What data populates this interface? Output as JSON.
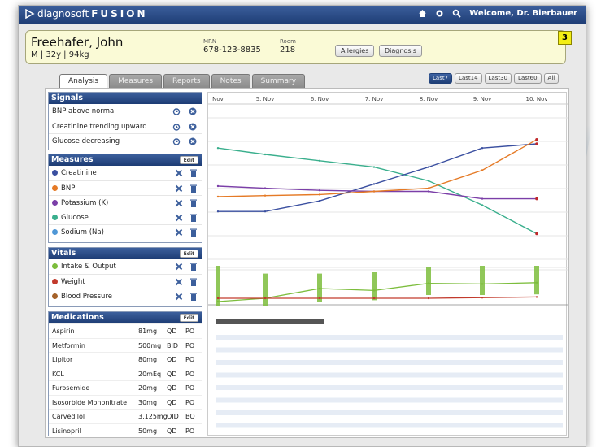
{
  "app": {
    "brand_light": "diagnosoft",
    "brand_bold": "FUSION",
    "welcome": "Welcome, Dr. Bierbauer"
  },
  "patient": {
    "name": "Freehafer, John",
    "demographics": "M | 32y | 94kg",
    "mrn_label": "MRN",
    "mrn": "678-123-8835",
    "room_label": "Room",
    "room": "218",
    "allergies_label": "Allergies",
    "diagnosis_label": "Diagnosis",
    "badge": "3"
  },
  "tabs": [
    {
      "label": "Analysis",
      "active": true
    },
    {
      "label": "Measures"
    },
    {
      "label": "Reports"
    },
    {
      "label": "Notes"
    },
    {
      "label": "Summary"
    }
  ],
  "ranges": [
    {
      "label": "Last7",
      "active": true
    },
    {
      "label": "Last14"
    },
    {
      "label": "Last30"
    },
    {
      "label": "Last60"
    },
    {
      "label": "All"
    }
  ],
  "signals": {
    "title": "Signals",
    "items": [
      "BNP above normal",
      "Creatinine trending upward",
      "Glucose decreasing"
    ]
  },
  "measures": {
    "title": "Measures",
    "edit": "Edit",
    "items": [
      {
        "label": "Creatinine",
        "color": "#3a4fa0"
      },
      {
        "label": "BNP",
        "color": "#e57a26"
      },
      {
        "label": "Potassium (K)",
        "color": "#7b3fa8"
      },
      {
        "label": "Glucose",
        "color": "#3aaf8d"
      },
      {
        "label": "Sodium (Na)",
        "color": "#4f97d6"
      }
    ]
  },
  "vitals": {
    "title": "Vitals",
    "edit": "Edit",
    "items": [
      {
        "label": "Intake & Output",
        "color": "#7cbd3c"
      },
      {
        "label": "Weight",
        "color": "#c23a2c"
      },
      {
        "label": "Blood Pressure",
        "color": "#a5622a"
      }
    ]
  },
  "medications": {
    "title": "Medications",
    "edit": "Edit",
    "items": [
      {
        "name": "Aspirin",
        "dose": "81mg",
        "freq": "QD",
        "route": "PO"
      },
      {
        "name": "Metformin",
        "dose": "500mg",
        "freq": "BID",
        "route": "PO"
      },
      {
        "name": "Lipitor",
        "dose": "80mg",
        "freq": "QD",
        "route": "PO"
      },
      {
        "name": "KCL",
        "dose": "20mEq",
        "freq": "QD",
        "route": "PO"
      },
      {
        "name": "Furosemide",
        "dose": "20mg",
        "freq": "QD",
        "route": "PO"
      },
      {
        "name": "Isosorbide Mononitrate",
        "dose": "30mg",
        "freq": "QD",
        "route": "PO"
      },
      {
        "name": "Carvedilol",
        "dose": "3.125mg",
        "freq": "QID",
        "route": "BO"
      },
      {
        "name": "Lisinopril",
        "dose": "50mg",
        "freq": "QD",
        "route": "PO"
      }
    ]
  },
  "chart_data": {
    "type": "line",
    "x": [
      "Nov",
      "5. Nov",
      "6. Nov",
      "7. Nov",
      "8. Nov",
      "9. Nov",
      "10. Nov"
    ],
    "series": [
      {
        "key": "glucose",
        "color": "#3aaf8d",
        "values": [
          0.86,
          0.8,
          0.74,
          0.68,
          0.55,
          0.32,
          0.05
        ]
      },
      {
        "key": "creatinine",
        "color": "#3a4fa0",
        "values": [
          0.26,
          0.26,
          0.36,
          0.52,
          0.68,
          0.86,
          0.9
        ]
      },
      {
        "key": "potassium",
        "color": "#7b3fa8",
        "values": [
          0.5,
          0.48,
          0.46,
          0.45,
          0.45,
          0.38,
          0.38
        ]
      },
      {
        "key": "bnp",
        "color": "#e57a26",
        "values": [
          0.4,
          0.41,
          0.42,
          0.45,
          0.48,
          0.65,
          0.94
        ]
      }
    ],
    "vitals_series": [
      {
        "key": "intake_output",
        "color": "#7cbd3c",
        "values": [
          0.35,
          0.4,
          0.55,
          0.52,
          0.63,
          0.62,
          0.64
        ]
      },
      {
        "key": "weight",
        "color": "#c23a2c",
        "values": [
          0.4,
          0.4,
          0.4,
          0.4,
          0.4,
          0.41,
          0.42
        ]
      }
    ],
    "vitals_ranges": [
      [
        0.28,
        0.9
      ],
      [
        0.28,
        0.78
      ],
      [
        0.35,
        0.78
      ],
      [
        0.37,
        0.8
      ],
      [
        0.45,
        0.88
      ],
      [
        0.45,
        0.9
      ],
      [
        0.46,
        0.9
      ]
    ]
  }
}
